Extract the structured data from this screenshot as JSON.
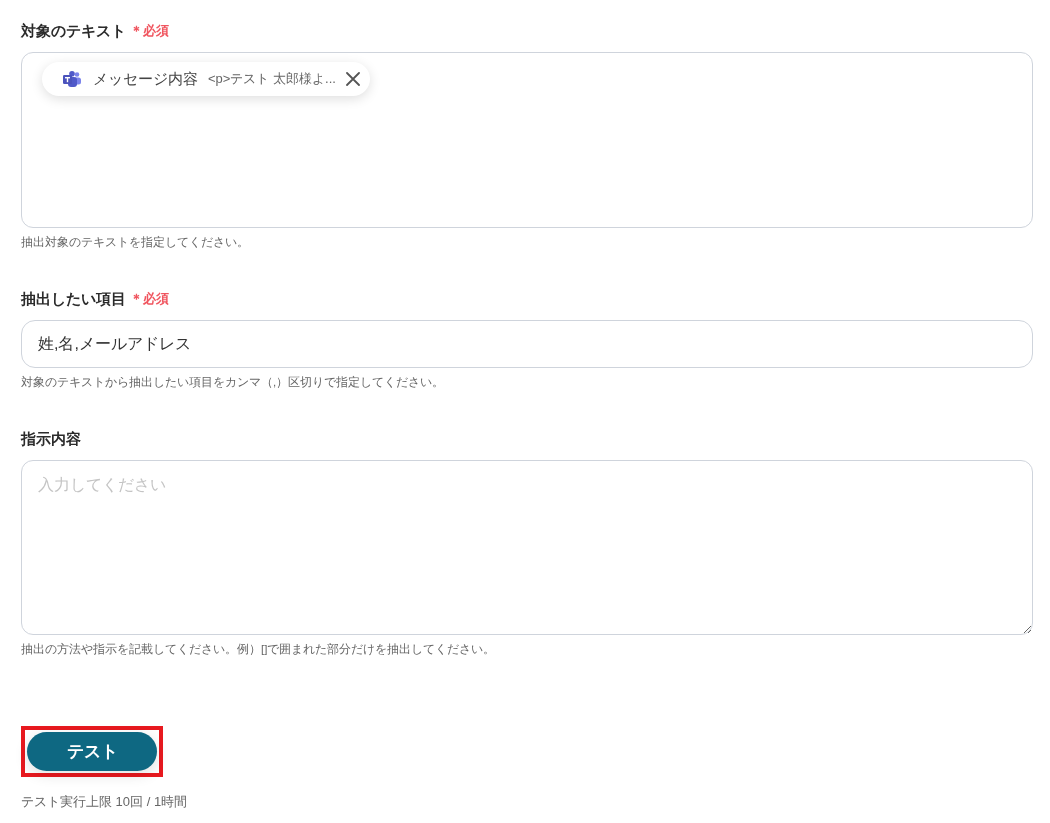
{
  "fields": [
    {
      "kind": "tokens",
      "label": "対象のテキスト",
      "required_mark": "＊必須",
      "tokens": [
        {
          "name": "メッセージ内容",
          "preview": "<p>テスト 太郎様よ..."
        }
      ],
      "hint": "抽出対象のテキストを指定してください。"
    },
    {
      "kind": "input",
      "label": "抽出したい項目",
      "required_mark": "＊必須",
      "value": "姓,名,メールアドレス",
      "hint": "対象のテキストから抽出したい項目をカンマ（,）区切りで指定してください。"
    },
    {
      "kind": "textarea",
      "label": "指示内容",
      "placeholder": "入力してください",
      "hint": "抽出の方法や指示を記載してください。例）[]で囲まれた部分だけを抽出してください。"
    }
  ],
  "test_button": {
    "label": "テスト",
    "highlighted": true
  },
  "limit_note": "テスト実行上限 10回 / 1時間"
}
